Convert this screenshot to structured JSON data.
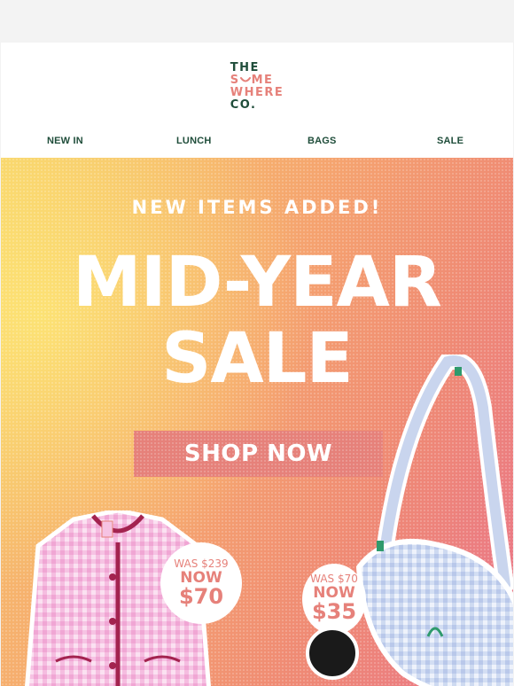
{
  "brand": {
    "line1": "THE",
    "line2_pre": "S",
    "line2_post": "ME",
    "line3": "WHERE",
    "line4": "CO.",
    "colors": {
      "dark": "#1f4d3a",
      "accent": "#e6817a"
    }
  },
  "nav": [
    {
      "label": "NEW IN"
    },
    {
      "label": "LUNCH"
    },
    {
      "label": "BAGS"
    },
    {
      "label": "SALE"
    }
  ],
  "hero": {
    "kicker": "NEW ITEMS ADDED!",
    "headline_line1": "MID-YEAR",
    "headline_line2": "SALE",
    "cta": "SHOP NOW"
  },
  "products": [
    {
      "name_icon": "jacket-image",
      "was": "WAS $239",
      "now": "NOW",
      "price": "$70"
    },
    {
      "name_icon": "bag-image",
      "was": "WAS $70",
      "now": "NOW",
      "price": "$35"
    }
  ]
}
